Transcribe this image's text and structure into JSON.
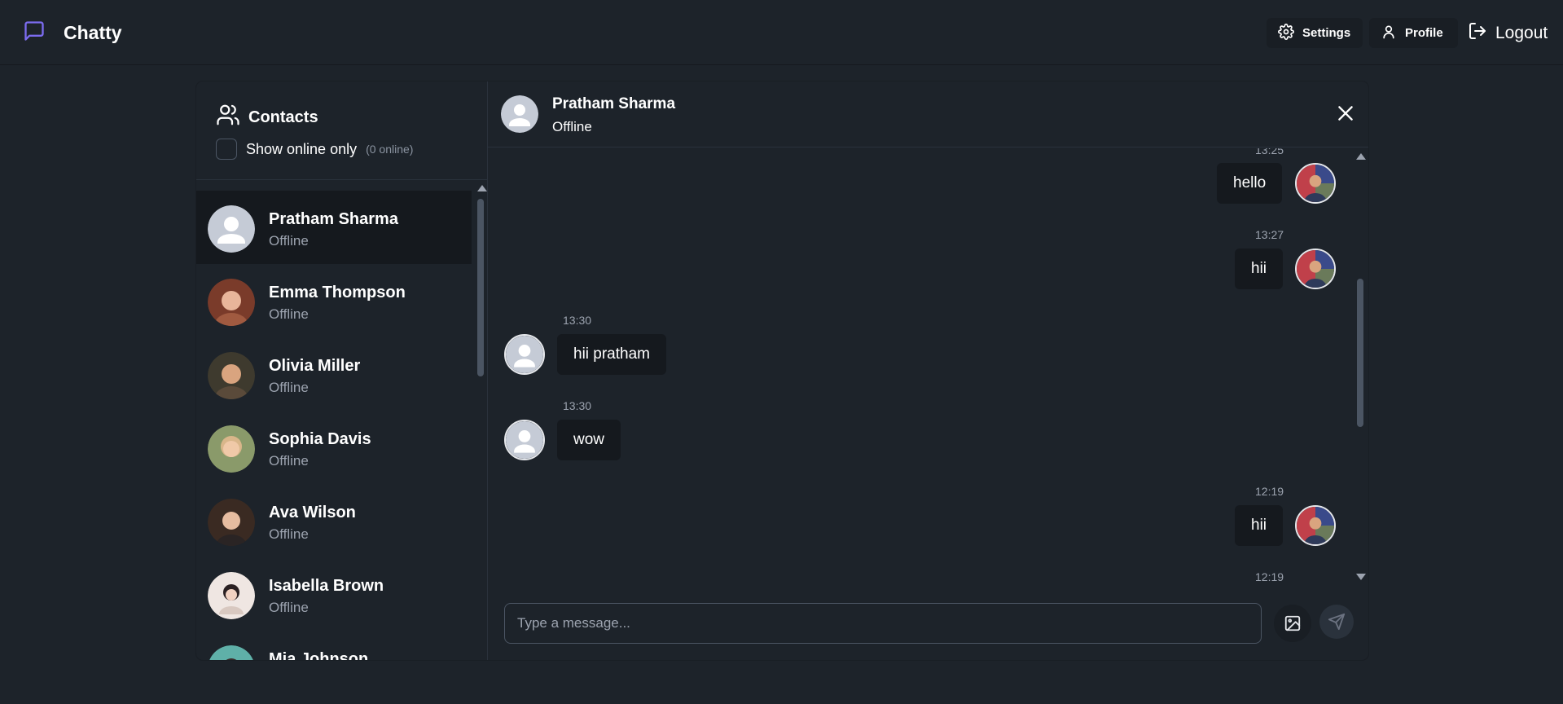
{
  "app": {
    "name": "Chatty"
  },
  "nav": {
    "settings": "Settings",
    "profile": "Profile",
    "logout": "Logout"
  },
  "sidebar": {
    "title": "Contacts",
    "online_toggle_label": "Show online only",
    "online_count": "(0 online)",
    "contacts": [
      {
        "name": "Pratham Sharma",
        "status": "Offline",
        "avatar": "default-avatar",
        "active": true
      },
      {
        "name": "Emma Thompson",
        "status": "Offline",
        "avatar": "photo"
      },
      {
        "name": "Olivia Miller",
        "status": "Offline",
        "avatar": "photo"
      },
      {
        "name": "Sophia Davis",
        "status": "Offline",
        "avatar": "photo"
      },
      {
        "name": "Ava Wilson",
        "status": "Offline",
        "avatar": "photo"
      },
      {
        "name": "Isabella Brown",
        "status": "Offline",
        "avatar": "photo"
      },
      {
        "name": "Mia Johnson",
        "status": "",
        "avatar": "photo"
      }
    ]
  },
  "chat": {
    "name": "Pratham Sharma",
    "status": "Offline",
    "messages": [
      {
        "time": "13:25",
        "text": "hello",
        "side": "sent"
      },
      {
        "time": "13:27",
        "text": "hii",
        "side": "sent"
      },
      {
        "time": "13:30",
        "text": "hii pratham",
        "side": "received"
      },
      {
        "time": "13:30",
        "text": "wow",
        "side": "received"
      },
      {
        "time": "12:19",
        "text": "hii",
        "side": "sent"
      },
      {
        "time": "12:19",
        "text": "",
        "side": "sent"
      }
    ],
    "input_placeholder": "Type a message..."
  },
  "colors": {
    "accent": "#7c6cf0",
    "background": "#1d232a",
    "bubble": "#15191e"
  }
}
